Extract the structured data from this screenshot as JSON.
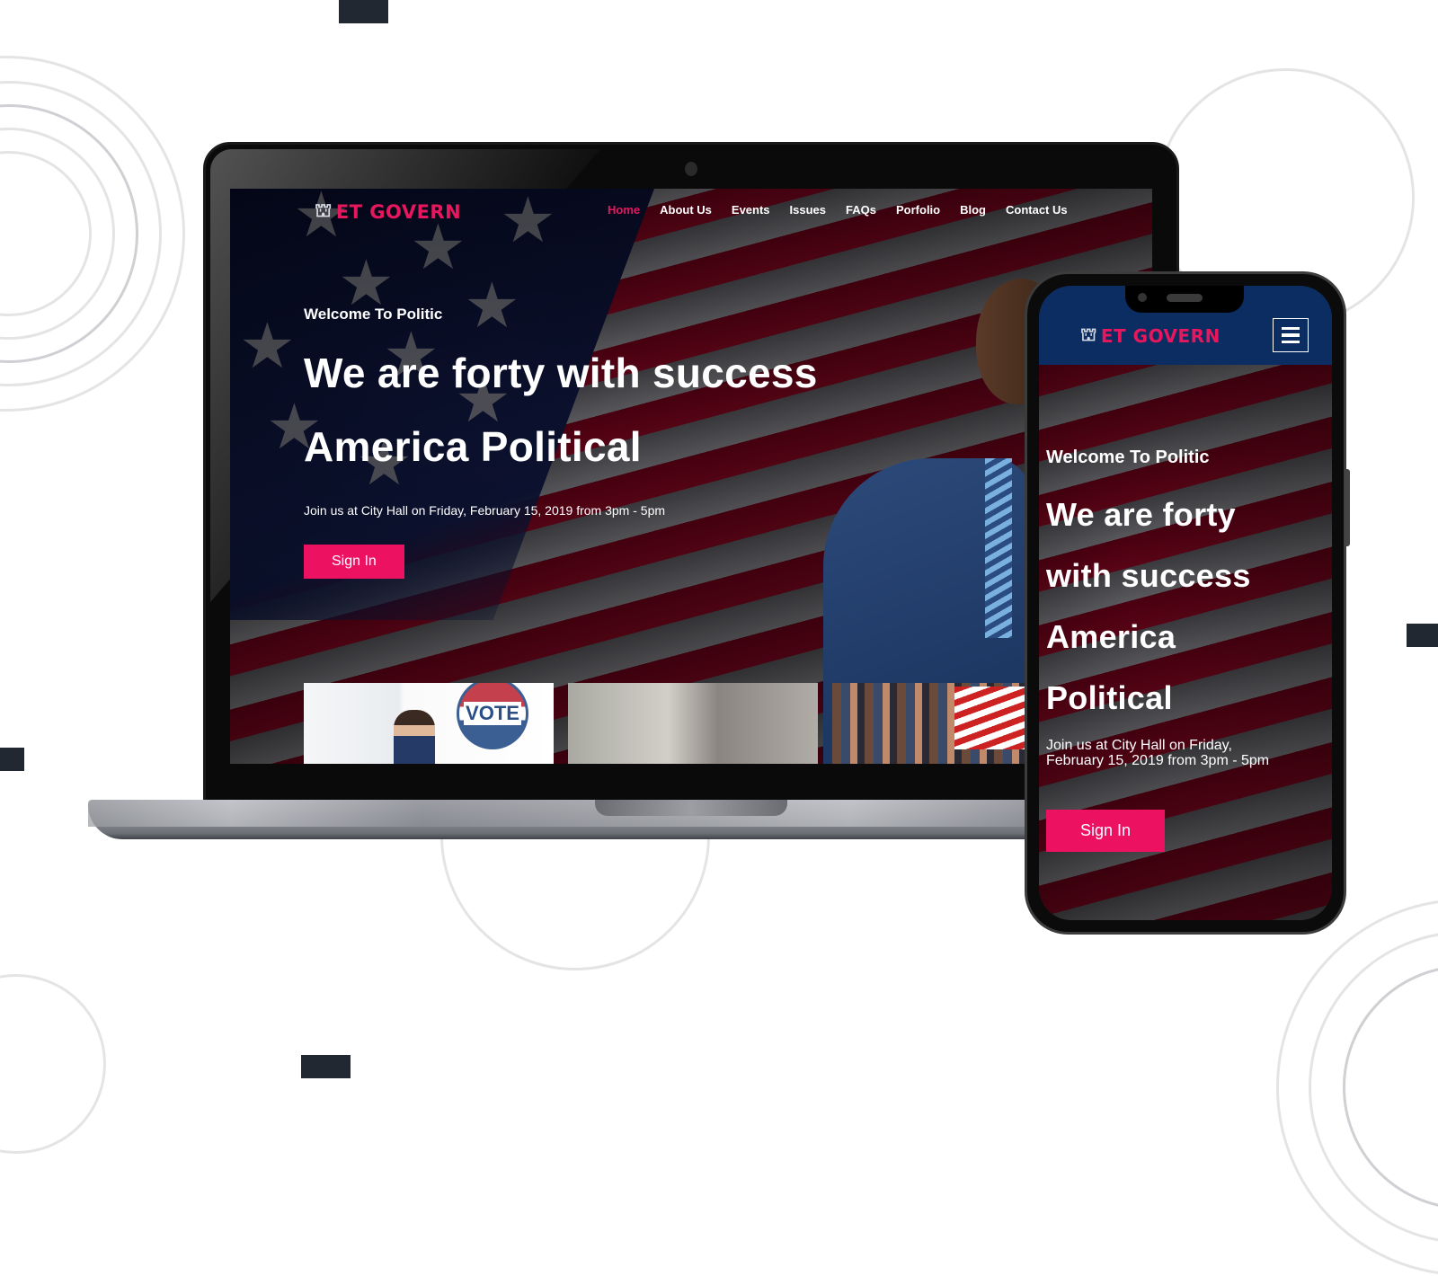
{
  "brand": {
    "name": "ET GOVERN",
    "icon": "capitol-building-icon",
    "accent_color": "#e8175d",
    "button_color": "#ed1261",
    "mobile_header_color": "#0c2d62"
  },
  "nav": {
    "items": [
      {
        "label": "Home",
        "active": true
      },
      {
        "label": "About Us",
        "active": false
      },
      {
        "label": "Events",
        "active": false
      },
      {
        "label": "Issues",
        "active": false
      },
      {
        "label": "FAQs",
        "active": false
      },
      {
        "label": "Porfolio",
        "active": false
      },
      {
        "label": "Blog",
        "active": false
      },
      {
        "label": "Contact Us",
        "active": false
      }
    ],
    "mobile_menu_icon": "hamburger-menu-icon"
  },
  "hero": {
    "kicker": "Welcome To Politic",
    "title_line1": "We are forty with success",
    "title_line2": "America Political",
    "subtitle": "Join us at City Hall on Friday, February 15, 2019 from 3pm - 5pm",
    "cta_label": "Sign In"
  },
  "mobile_hero": {
    "kicker": "Welcome To Politic",
    "title_lines": [
      "We are forty",
      "with success",
      "America",
      "Political"
    ],
    "subtitle_line1": "Join us at City Hall on Friday,",
    "subtitle_line2": "February 15, 2019 from 3pm - 5pm",
    "cta_label": "Sign In"
  },
  "thumbnails": [
    {
      "alt": "Candidate with VOTE badge",
      "badge_text": "VOTE"
    },
    {
      "alt": "Men at a meeting"
    },
    {
      "alt": "Crowd rally with US flag"
    }
  ]
}
